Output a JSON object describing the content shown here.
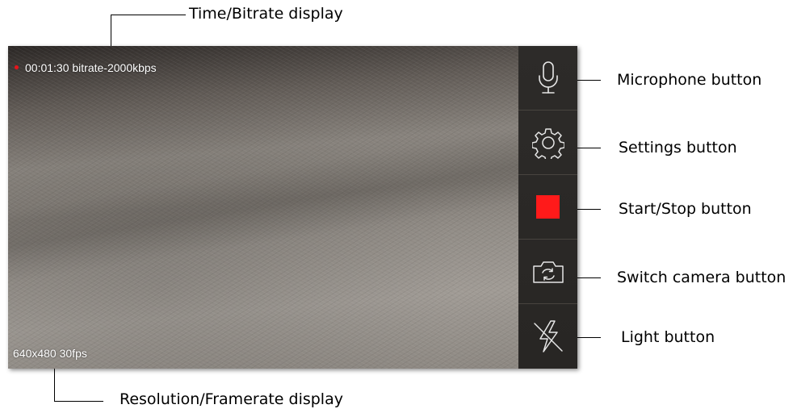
{
  "callouts": {
    "time_bitrate": "Time/Bitrate display",
    "resolution_framerate": "Resolution/Framerate display",
    "microphone": "Microphone button",
    "settings": "Settings button",
    "start_stop": "Start/Stop button",
    "switch_camera": "Switch camera button",
    "light": "Light button"
  },
  "screen": {
    "status_text": "00:01:30 bitrate-2000kbps",
    "resolution_text": "640x480 30fps"
  },
  "sidebar": {
    "buttons": [
      {
        "icon": "microphone-icon"
      },
      {
        "icon": "gear-icon"
      },
      {
        "icon": "stop-icon"
      },
      {
        "icon": "switch-camera-icon"
      },
      {
        "icon": "flash-off-icon"
      }
    ]
  },
  "colors": {
    "record_indicator": "#e8141b",
    "stop_button": "#ff1a1a",
    "sidebar_bg": "#2b2927",
    "icon_stroke": "#e6e6e6"
  }
}
